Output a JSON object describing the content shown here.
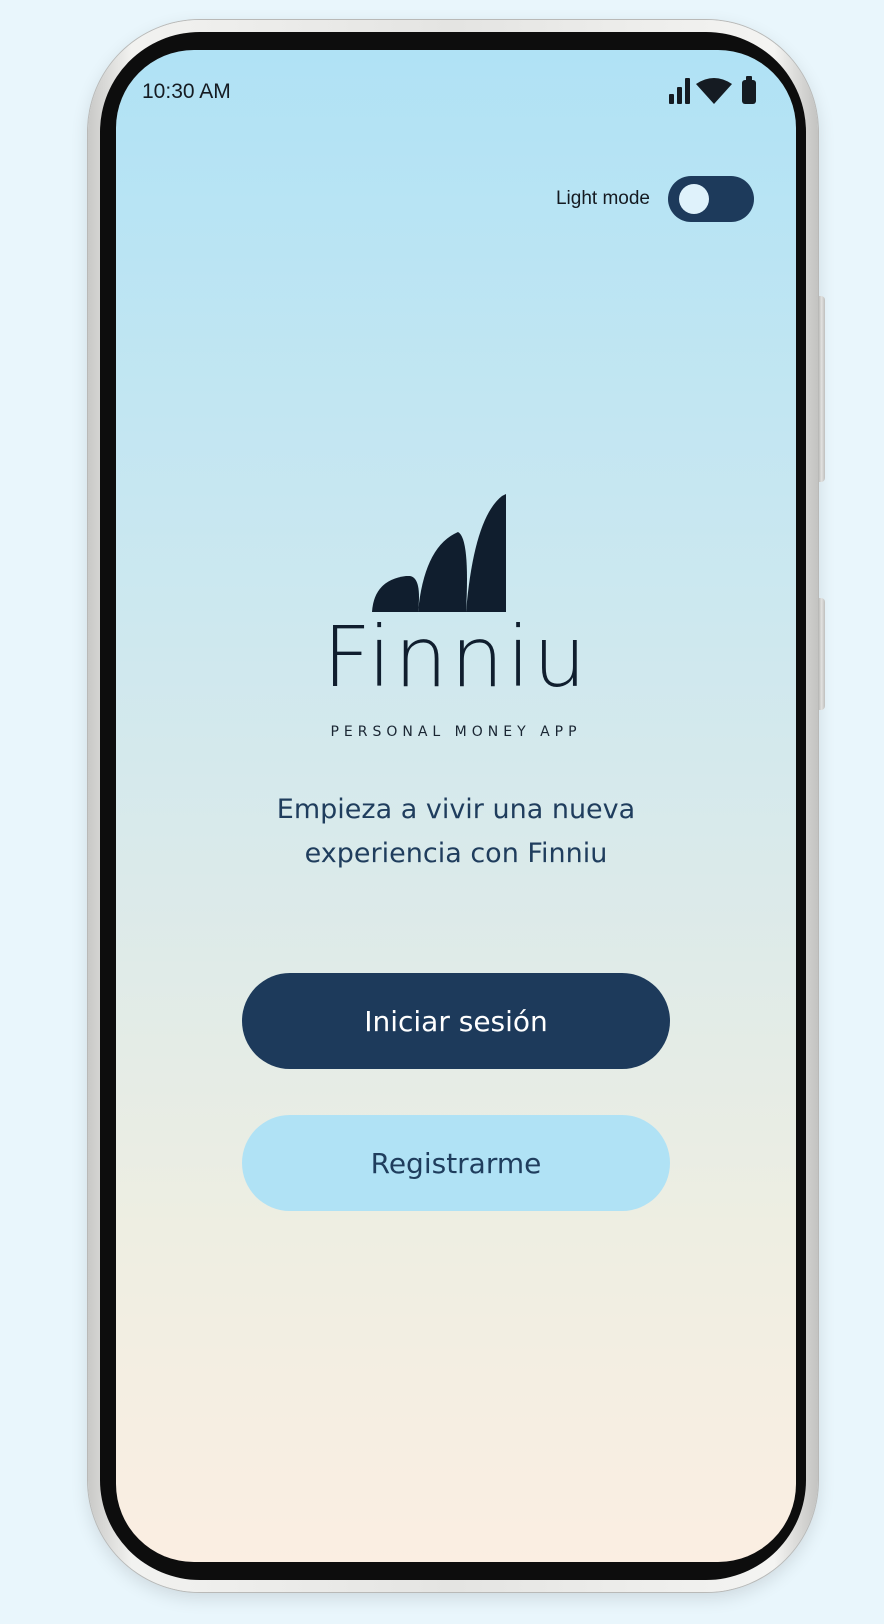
{
  "status_bar": {
    "time": "10:30 AM",
    "icons": [
      "signal-icon",
      "wifi-icon",
      "battery-icon"
    ]
  },
  "theme_toggle": {
    "label": "Light mode",
    "state": "off"
  },
  "brand": {
    "name": "Finniu",
    "subtitle": "PERSONAL MONEY APP",
    "logo_icon": "finniu-bars-logo"
  },
  "tagline": "Empieza a vivir una nueva\nexperiencia con  Finniu",
  "actions": {
    "login_label": "Iniciar sesión",
    "register_label": "Registrarme"
  },
  "colors": {
    "primary": "#1d3a5b",
    "secondary": "#b0e2f5",
    "logo": "#101e2e",
    "background": "#e9f6fc"
  }
}
